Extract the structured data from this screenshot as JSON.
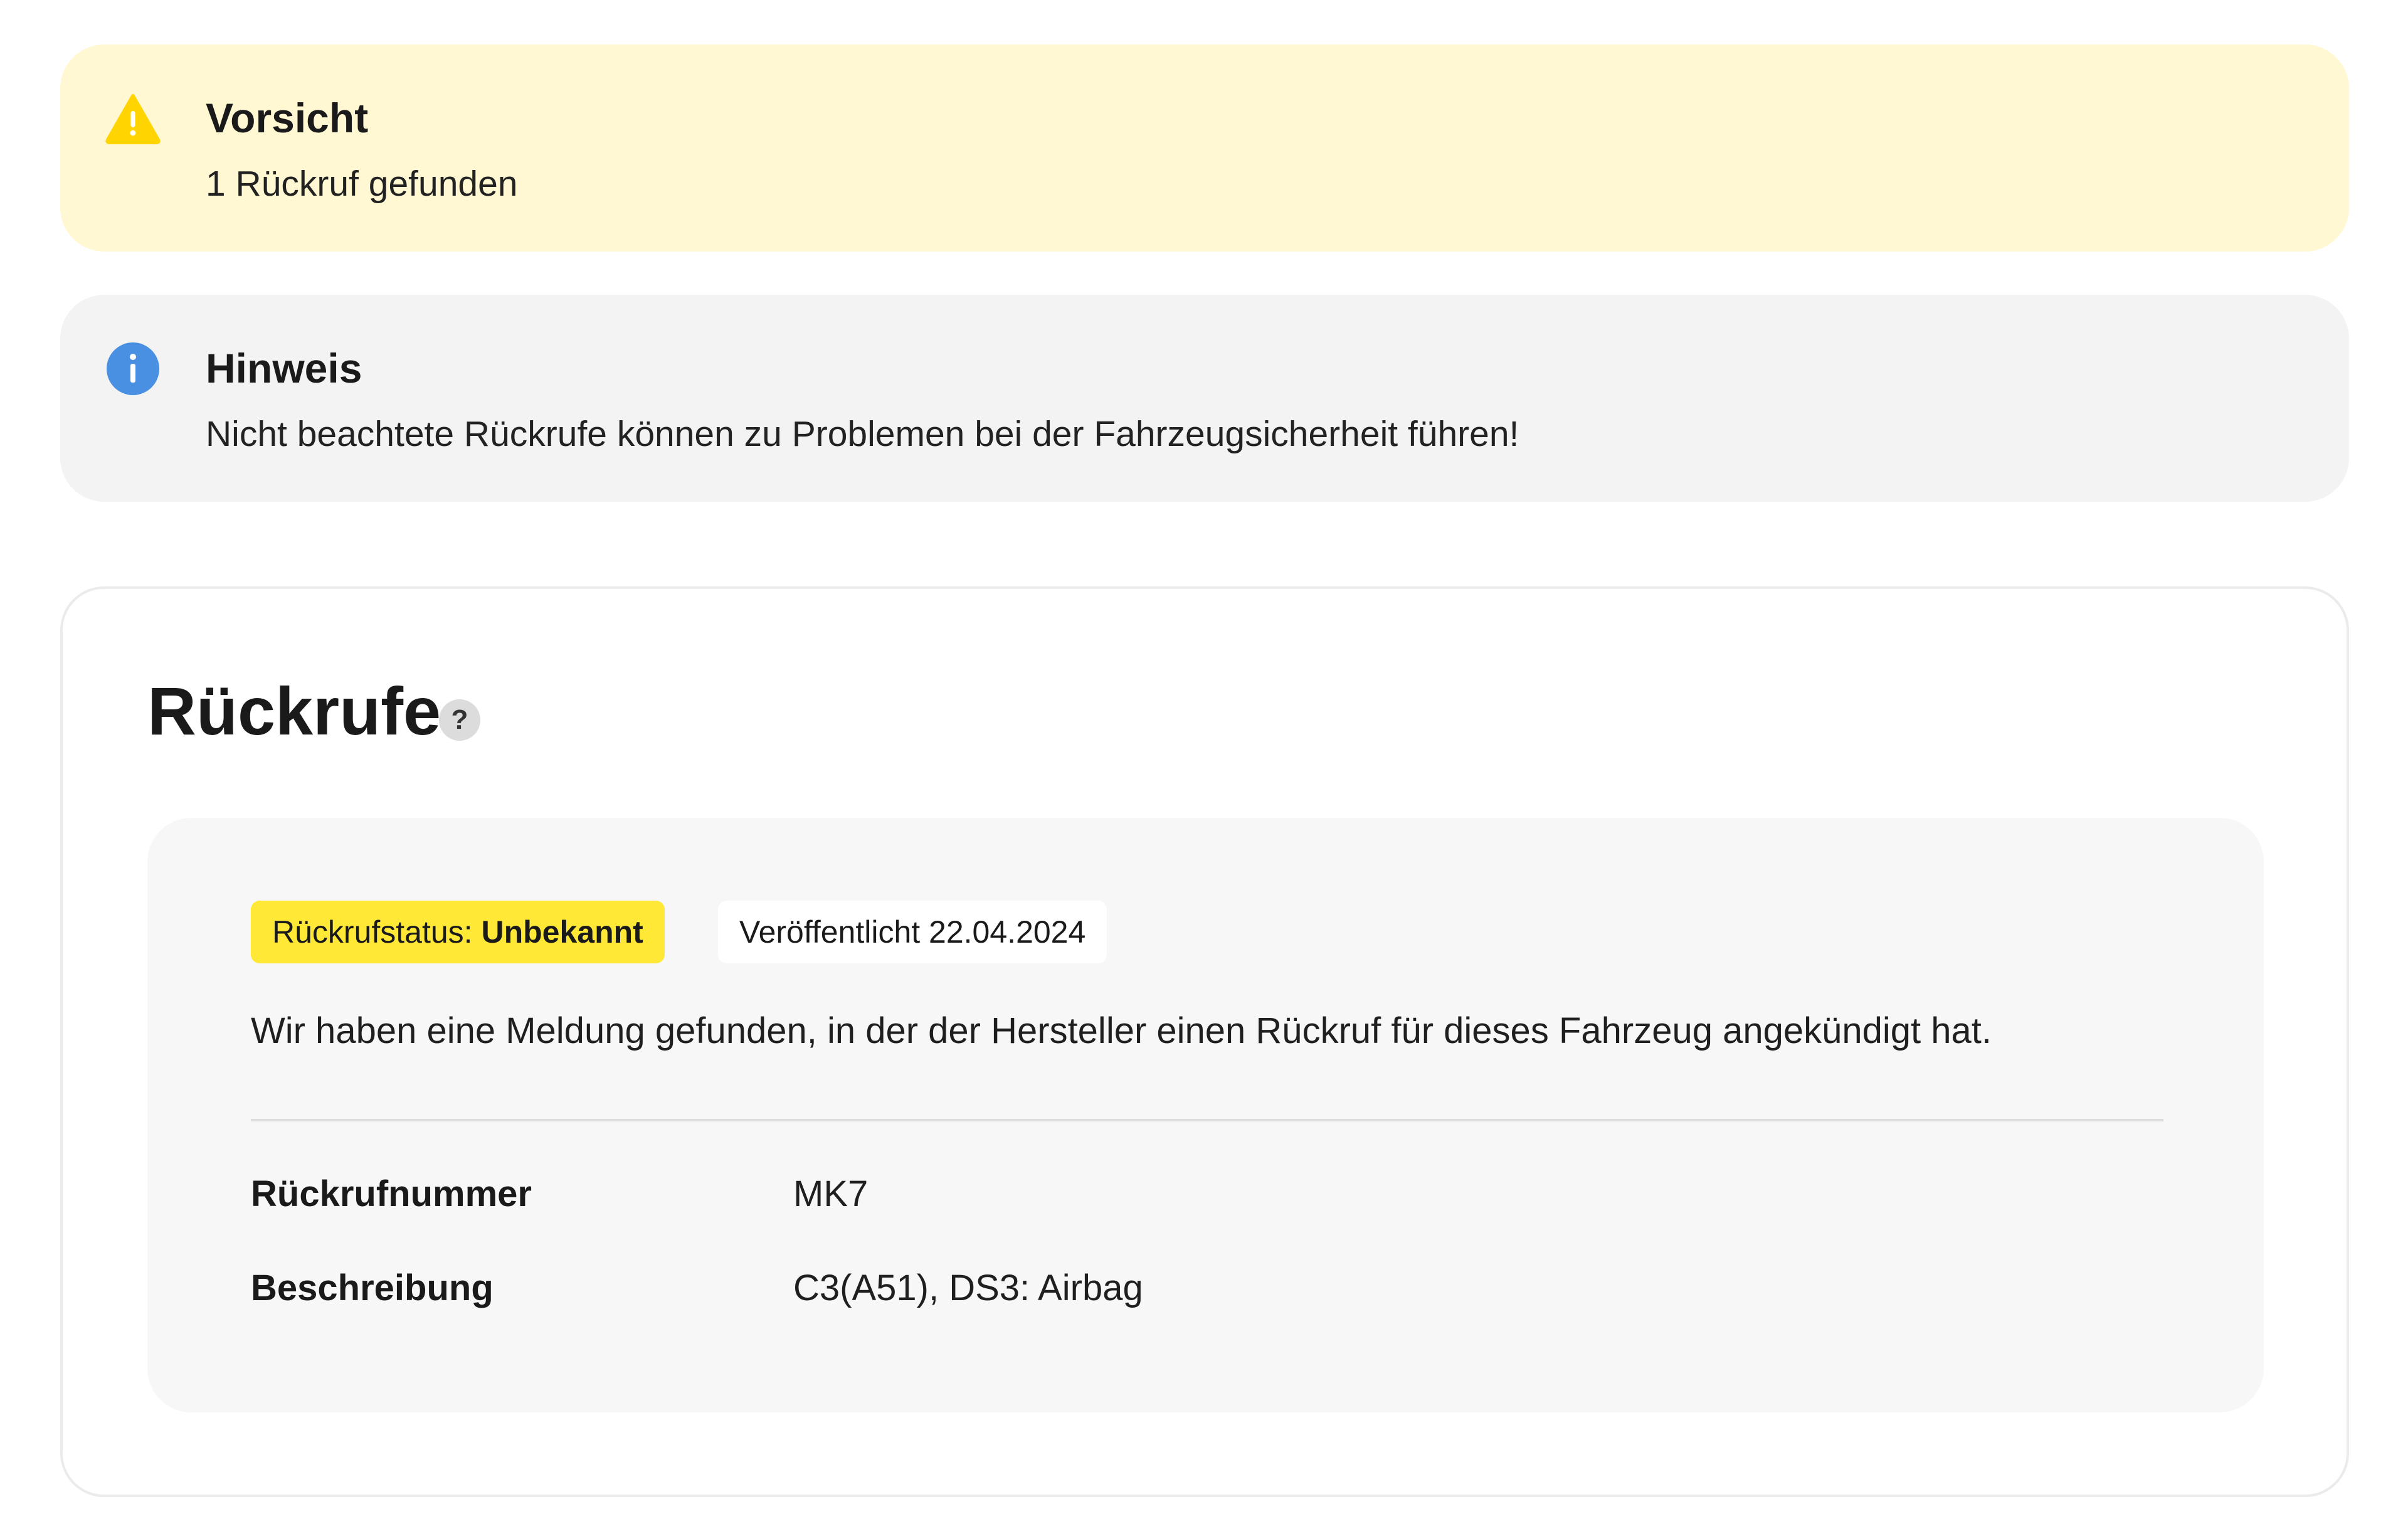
{
  "warning": {
    "title": "Vorsicht",
    "text": "1 Rückruf gefunden",
    "icon": "warning-triangle-icon",
    "color": "#ffd400",
    "background": "#fff8d2"
  },
  "info": {
    "title": "Hinweis",
    "text": "Nicht beachtete Rückrufe können zu Problemen bei der Fahrzeugsicherheit führen!",
    "icon": "info-circle-icon",
    "color": "#4a90e2",
    "background": "#f3f3f3"
  },
  "recalls": {
    "title": "Rückrufe",
    "help_symbol": "?",
    "items": [
      {
        "status_label": "Rückrufstatus:",
        "status_value": "Unbekannt",
        "status_color": "#ffe936",
        "published": "Veröffentlicht 22.04.2024",
        "description": "Wir haben eine Meldung gefunden, in der der Hersteller einen Rückruf für dieses Fahrzeug angekündigt hat.",
        "details": [
          {
            "label": "Rückrufnummer",
            "value": "MK7"
          },
          {
            "label": "Beschreibung",
            "value": "C3(A51), DS3: Airbag"
          }
        ]
      }
    ]
  }
}
